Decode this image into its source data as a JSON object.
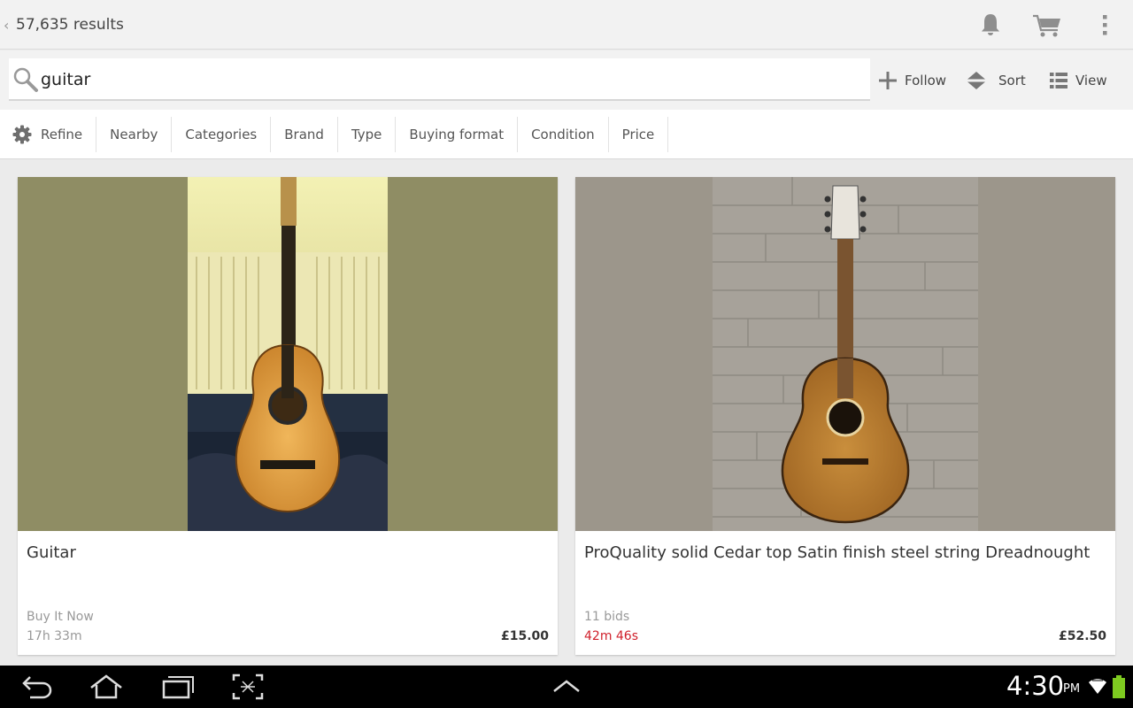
{
  "header": {
    "back_glyph": "‹",
    "results_count": "57,635 results",
    "icons": [
      "bell-icon",
      "cart-icon",
      "overflow-menu-icon"
    ]
  },
  "search": {
    "query": "guitar",
    "actions": {
      "follow": "Follow",
      "sort": "Sort",
      "view": "View"
    }
  },
  "filters": [
    "Refine",
    "Nearby",
    "Categories",
    "Brand",
    "Type",
    "Buying format",
    "Condition",
    "Price"
  ],
  "listings": [
    {
      "title": "Guitar",
      "format": "Buy It Now",
      "time_left": "17h 33m",
      "price": "£15.00"
    },
    {
      "title": "ProQuality solid Cedar top Satin finish steel string Dreadnought",
      "format": "11 bids",
      "time_left": "42m 46s",
      "price": "£52.50"
    }
  ],
  "colors": {
    "urgent_time": "#d0202b",
    "battery": "#7ecb20"
  },
  "system_bar": {
    "time": "4:30",
    "ampm": "PM"
  }
}
